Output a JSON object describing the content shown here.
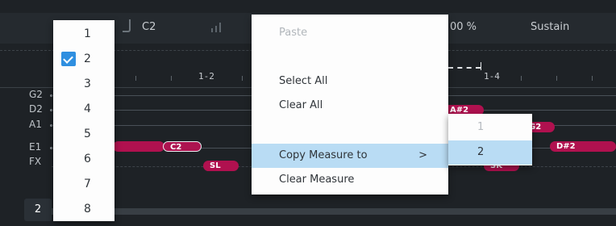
{
  "header": {
    "note_label": "C2",
    "percent_label": "00 %",
    "sustain_label": "Sustain"
  },
  "ruler": {
    "measure_a": "1-2",
    "measure_b": "1-4"
  },
  "rows": [
    {
      "label": "G2"
    },
    {
      "label": "D2"
    },
    {
      "label": "A1"
    },
    {
      "label": "E1"
    },
    {
      "label": "FX"
    }
  ],
  "notes": {
    "a_sharp2": "A#2",
    "g2": "G2",
    "c2": "C2",
    "d_sharp2": "D#2",
    "sl": "SL",
    "sk": "SK"
  },
  "measure_selector": {
    "current": "2"
  },
  "number_menu": {
    "items": [
      "1",
      "2",
      "3",
      "4",
      "5",
      "6",
      "7",
      "8"
    ],
    "selected": "2"
  },
  "context_menu": {
    "paste": "Paste",
    "select_all": "Select All",
    "clear_all": "Clear All",
    "copy_measure_to": "Copy Measure to",
    "submenu_arrow": ">",
    "clear_measure": "Clear Measure"
  },
  "submenu": {
    "items": [
      "1",
      "2"
    ],
    "active": "2"
  },
  "colors": {
    "note_fill": "#b0114f",
    "menu_highlight": "#b9dcf4",
    "check_accent": "#2f8fe0"
  }
}
